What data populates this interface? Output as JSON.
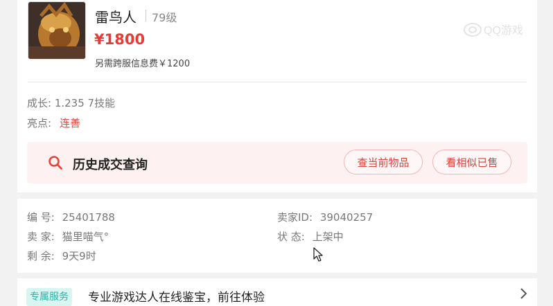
{
  "item": {
    "name": "雷鸟人",
    "level": "79级",
    "price": "¥1800",
    "fee_note": "另需跨服信息费￥1200"
  },
  "attributes": {
    "growth": "成长: 1.235 7技能",
    "highlight_label": "亮点:",
    "highlight_value": "连善"
  },
  "history": {
    "title": "历史成交查询",
    "btn_current": "查当前物品",
    "btn_similar": "看相似已售"
  },
  "details": {
    "id_label": "编 号:",
    "id_value": "25401788",
    "seller_id_label": "卖家ID:",
    "seller_id_value": "39040257",
    "seller_label": "卖 家:",
    "seller_value": "猫里喵气°",
    "status_label": "状 态:",
    "status_value": "上架中",
    "remaining_label": "剩 余:",
    "remaining_value": "9天9时"
  },
  "service": {
    "badge": "专属服务",
    "text": "专业游戏达人在线鉴宝，前往体验"
  },
  "colors": {
    "accent_red": "#e83b35",
    "history_bg": "#fdf1f1",
    "badge_teal": "#2bb3a6"
  }
}
